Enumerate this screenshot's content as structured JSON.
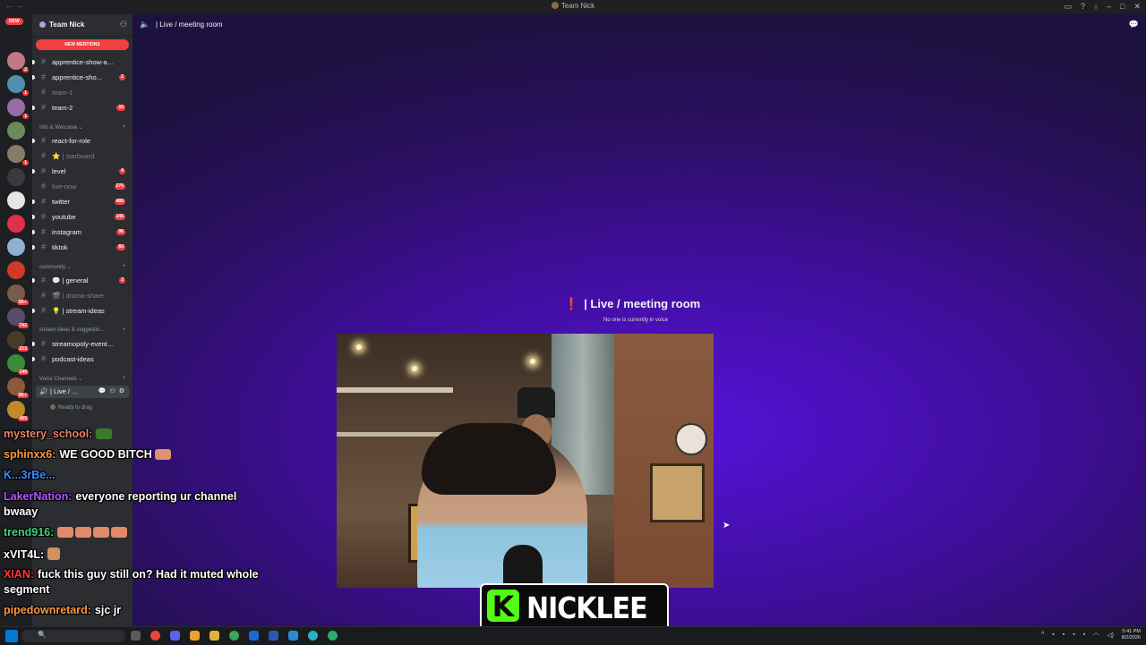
{
  "window": {
    "title": "Team Nick"
  },
  "server": {
    "name": "Team Nick",
    "new_pill": "NEW",
    "new_mentions": "NEW MENTIONS"
  },
  "channels": [
    {
      "label": "apprentice-show-ap...",
      "count": "",
      "state": "bright"
    },
    {
      "label": "apprentice-sho...",
      "count": "2",
      "state": "bright"
    },
    {
      "label": "team-1",
      "count": "",
      "state": "dim"
    },
    {
      "label": "team-2",
      "count": "10",
      "state": "bright"
    }
  ],
  "categories": {
    "info": "Info & Welcome",
    "community": "community",
    "stream": "stream ideas & suggestio...",
    "voice": "Voice Channels"
  },
  "info_channels": [
    {
      "label": "react-for-role",
      "count": "",
      "state": "bright"
    },
    {
      "label": "⭐ | starboard",
      "count": "",
      "state": "dim"
    },
    {
      "label": "level",
      "count": "4",
      "state": "bright"
    },
    {
      "label": "live-now",
      "count": "276",
      "state": "dim"
    },
    {
      "label": "twitter",
      "count": "489",
      "state": "bright"
    },
    {
      "label": "youtube",
      "count": "146",
      "state": "bright"
    },
    {
      "label": "instagram",
      "count": "96",
      "state": "bright"
    },
    {
      "label": "tiktok",
      "count": "60",
      "state": "bright"
    }
  ],
  "community_channels": [
    {
      "label": "💬 | general",
      "count": "3",
      "state": "bright"
    },
    {
      "label": "🎬 | drama-share",
      "count": "",
      "state": "dim"
    },
    {
      "label": "💡 | stream-ideas",
      "count": "",
      "state": "bright"
    }
  ],
  "stream_channels": [
    {
      "label": "streamopoly-event-i...",
      "count": "",
      "state": "bright"
    },
    {
      "label": "podcast-ideas",
      "count": "",
      "state": "bright"
    }
  ],
  "voice": {
    "active_label": "| Live / ...",
    "ready": "Ready to drag"
  },
  "header": {
    "channel": "| Live / meeting room"
  },
  "voice_room": {
    "title": "| Live / meeting room",
    "subtitle": "No one is currently in voice"
  },
  "overlay": {
    "logo_letter": "K",
    "logo_name": "NICKLEE"
  },
  "chat": [
    {
      "user": "mystery_school:",
      "text": "",
      "color": "#e8836b"
    },
    {
      "user": "sphinxx6:",
      "text": "WE GOOD BITCH",
      "color": "#ff9a3c"
    },
    {
      "user": "K...3rBe...",
      "text": "",
      "color": "#3c8cff"
    },
    {
      "user": "LakerNation:",
      "text": "everyone reporting ur channel",
      "color": "#b455ff"
    },
    {
      "user": "",
      "text": "bwaay",
      "color": "#ffffff"
    },
    {
      "user": "trend916:",
      "text": "",
      "color": "#3fd07a"
    },
    {
      "user": "xVIT4L:",
      "text": "",
      "color": "#ffffff"
    },
    {
      "user": "XIAN:",
      "text": "fuck this guy still on? Had it muted whole",
      "color": "#ff3838"
    },
    {
      "user": "",
      "text": "segment",
      "color": "#ffffff"
    },
    {
      "user": "pipedownretard:",
      "text": "sjc jr",
      "color": "#ff9a3c"
    }
  ],
  "taskbar": {
    "time": "5:41 PM",
    "date": "8/2/2026"
  }
}
